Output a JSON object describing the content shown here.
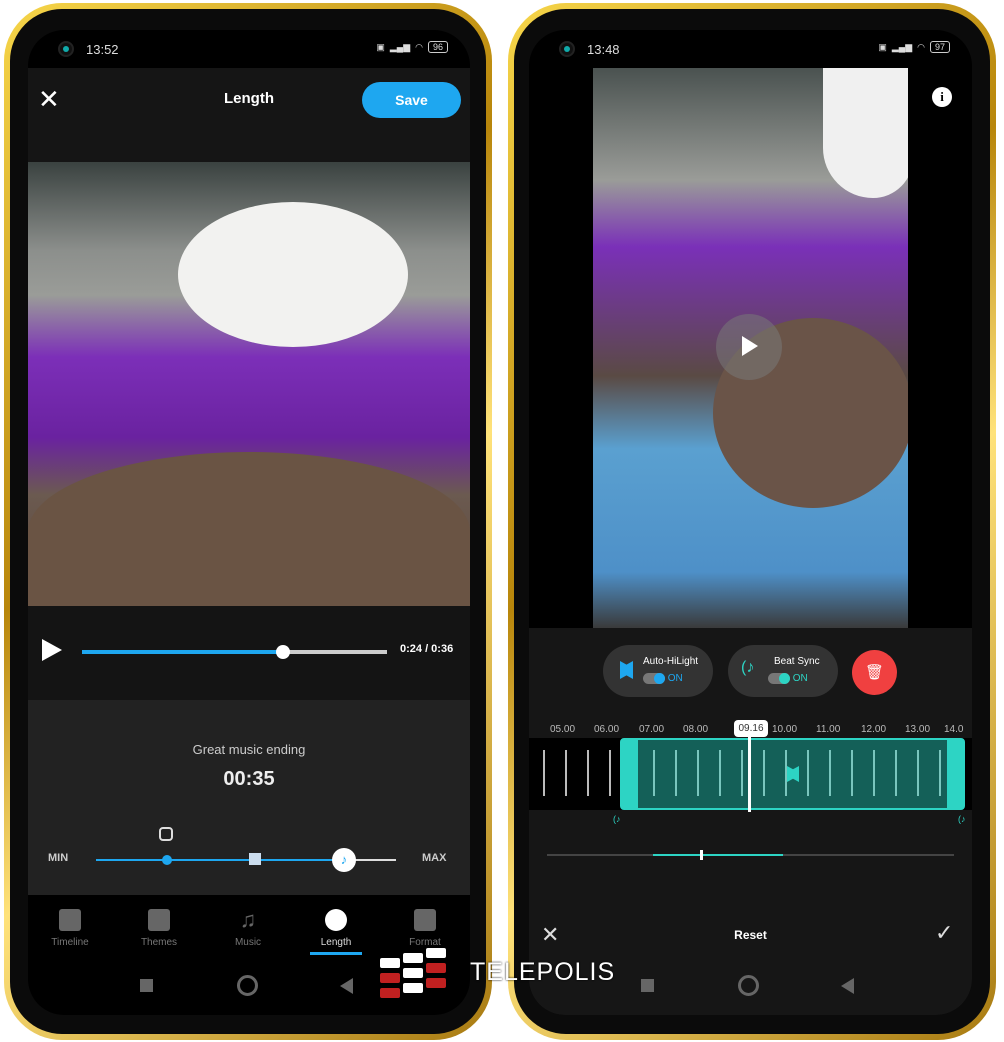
{
  "left": {
    "status": {
      "time": "13:52",
      "battery": "96"
    },
    "header": {
      "title": "Length",
      "save_label": "Save",
      "close_icon": "close-icon"
    },
    "player": {
      "time": "0:24 / 0:36",
      "progress_percent": 66
    },
    "panel": {
      "label": "Great music ending",
      "duration": "00:35",
      "min_label": "MIN",
      "max_label": "MAX",
      "slider_icon": "instagram-icon"
    },
    "nav": [
      {
        "label": "Timeline",
        "icon": "timeline-icon"
      },
      {
        "label": "Themes",
        "icon": "themes-icon"
      },
      {
        "label": "Music",
        "icon": "music-icon"
      },
      {
        "label": "Length",
        "icon": "stopwatch-icon",
        "active": true
      },
      {
        "label": "Format",
        "icon": "format-icon"
      }
    ]
  },
  "right": {
    "status": {
      "time": "13:48",
      "battery": "97"
    },
    "auto_hilight": {
      "label": "Auto-HiLight",
      "state": "ON"
    },
    "beat_sync": {
      "label": "Beat Sync",
      "state": "ON"
    },
    "ruler": [
      "05.00",
      "06.00",
      "07.00",
      "08.00",
      "10.00",
      "11.00",
      "12.00",
      "13.00",
      "14.0"
    ],
    "playhead": "09.16",
    "reset_label": "Reset"
  },
  "watermark": "TELEPOLIS",
  "colors": {
    "accent_blue": "#1ea7f0",
    "accent_teal": "#2dd4c4",
    "delete_red": "#f04040",
    "frame_gold": "#d4a82a"
  }
}
